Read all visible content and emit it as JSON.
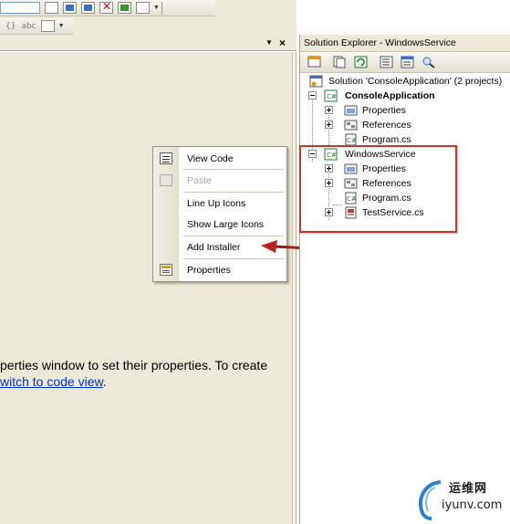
{
  "designer": {
    "message_line1": "perties window to set their properties. To create",
    "message_link": "witch to code view",
    "message_end": "."
  },
  "context_menu": {
    "items": [
      {
        "label": "View Code",
        "icon": "view-code-icon",
        "enabled": true
      },
      {
        "label": "Paste",
        "icon": "paste-icon",
        "enabled": false
      },
      {
        "label": "Line Up Icons",
        "enabled": true
      },
      {
        "label": "Show Large Icons",
        "enabled": true
      },
      {
        "label": "Add Installer",
        "enabled": true
      },
      {
        "label": "Properties",
        "icon": "properties-icon",
        "enabled": true
      }
    ]
  },
  "solution_explorer": {
    "title": "Solution Explorer - WindowsService",
    "solution_label": "Solution 'ConsoleApplication' (2 projects)",
    "projects": [
      {
        "name": "ConsoleApplication",
        "bold": true,
        "expanded": true,
        "children": [
          {
            "label": "Properties",
            "icon": "properties-folder-icon",
            "expandable": true
          },
          {
            "label": "References",
            "icon": "references-folder-icon",
            "expandable": true
          },
          {
            "label": "Program.cs",
            "icon": "csharp-file-icon",
            "expandable": false
          }
        ]
      },
      {
        "name": "WindowsService",
        "bold": false,
        "expanded": true,
        "children": [
          {
            "label": "Properties",
            "icon": "properties-folder-icon",
            "expandable": true
          },
          {
            "label": "References",
            "icon": "references-folder-icon",
            "expandable": true
          },
          {
            "label": "Program.cs",
            "icon": "csharp-file-icon",
            "expandable": false
          },
          {
            "label": "TestService.cs",
            "icon": "service-file-icon",
            "expandable": true
          }
        ]
      }
    ]
  },
  "toolbar": {
    "glyph_format": "{}",
    "glyph_spell": "abc"
  },
  "watermark": {
    "cn": "运维网",
    "en": "iyunv.com"
  },
  "colors": {
    "highlight_red": "#c0392b",
    "link_blue": "#0033cc",
    "chrome": "#ece9d8"
  }
}
